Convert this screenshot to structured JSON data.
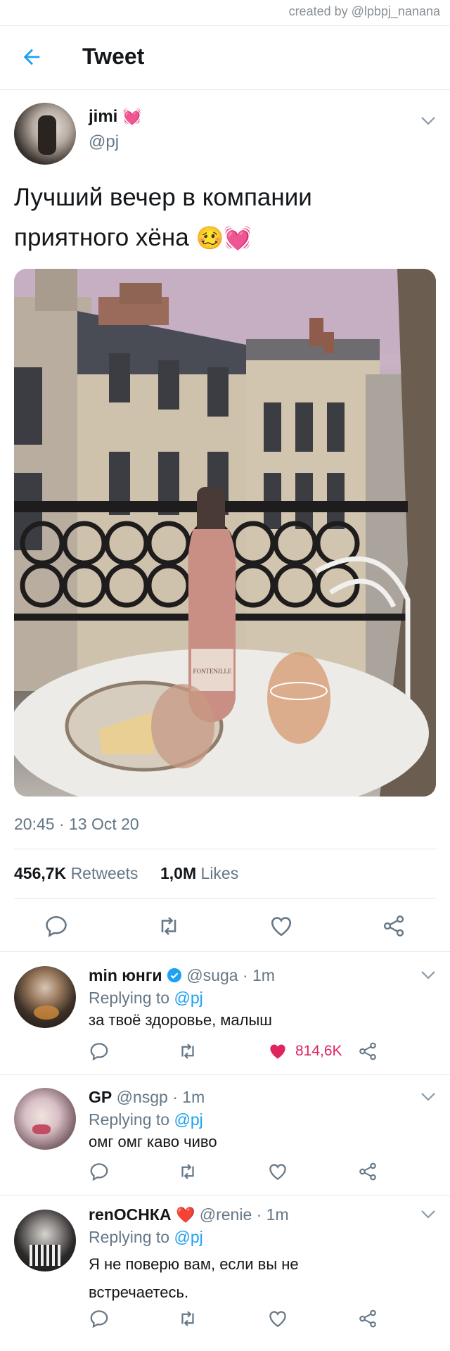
{
  "credit": "created by @lpbpj_nanana",
  "header": {
    "title": "Tweet",
    "back_icon": "back-arrow-icon"
  },
  "tweet": {
    "name": "jimi",
    "name_emoji": "💓",
    "handle": "@pj",
    "text_line1": "Лучший вечер в компании",
    "text_line2": "приятного хёна",
    "text_emoji": "🥴💓",
    "photo_bottle_label": "FONTENILLE",
    "time": "20:45 · 13 Oct 20",
    "retweets_count": "456,7K",
    "retweets_label": "Retweets",
    "likes_count": "1,0M",
    "likes_label": "Likes"
  },
  "replies": [
    {
      "name": "min юнги",
      "verified": true,
      "handle_time": "@suga · 1m",
      "replying_prefix": "Replying to",
      "replying_to": "@pj",
      "text": "за твоё здоровье, малыш",
      "likes": "814,6K",
      "liked": true
    },
    {
      "name": "GP",
      "handle_time": "@nsgp · 1m",
      "replying_prefix": "Replying to",
      "replying_to": "@pj",
      "text": "омг омг каво чиво",
      "likes": "",
      "liked": false
    },
    {
      "name": "renОСНКА",
      "name_emoji": "❤️",
      "handle_time": "@renie · 1m",
      "replying_prefix": "Replying to",
      "replying_to": "@pj",
      "text_line1": "Я не поверю вам, если вы не",
      "text_line2": "встречаетесь.",
      "likes": "",
      "liked": false
    }
  ],
  "colors": {
    "accent": "#1da1f2",
    "like_red": "#e0245e",
    "muted": "#657786",
    "divider": "#e1e8ed"
  }
}
